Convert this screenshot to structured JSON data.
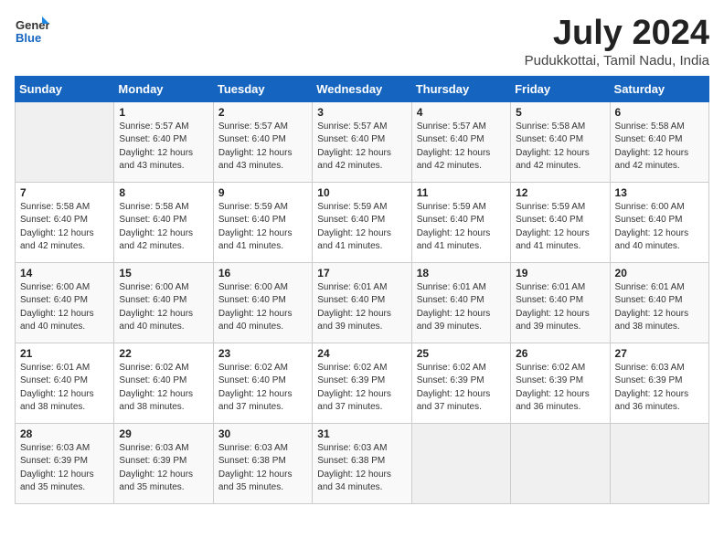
{
  "header": {
    "logo_general": "General",
    "logo_blue": "Blue",
    "month_year": "July 2024",
    "location": "Pudukkottai, Tamil Nadu, India"
  },
  "days_of_week": [
    "Sunday",
    "Monday",
    "Tuesday",
    "Wednesday",
    "Thursday",
    "Friday",
    "Saturday"
  ],
  "weeks": [
    [
      {
        "day": null,
        "sunrise": null,
        "sunset": null,
        "daylight": null
      },
      {
        "day": "1",
        "sunrise": "5:57 AM",
        "sunset": "6:40 PM",
        "daylight": "12 hours and 43 minutes."
      },
      {
        "day": "2",
        "sunrise": "5:57 AM",
        "sunset": "6:40 PM",
        "daylight": "12 hours and 43 minutes."
      },
      {
        "day": "3",
        "sunrise": "5:57 AM",
        "sunset": "6:40 PM",
        "daylight": "12 hours and 42 minutes."
      },
      {
        "day": "4",
        "sunrise": "5:57 AM",
        "sunset": "6:40 PM",
        "daylight": "12 hours and 42 minutes."
      },
      {
        "day": "5",
        "sunrise": "5:58 AM",
        "sunset": "6:40 PM",
        "daylight": "12 hours and 42 minutes."
      },
      {
        "day": "6",
        "sunrise": "5:58 AM",
        "sunset": "6:40 PM",
        "daylight": "12 hours and 42 minutes."
      }
    ],
    [
      {
        "day": "7",
        "sunrise": "5:58 AM",
        "sunset": "6:40 PM",
        "daylight": "12 hours and 42 minutes."
      },
      {
        "day": "8",
        "sunrise": "5:58 AM",
        "sunset": "6:40 PM",
        "daylight": "12 hours and 42 minutes."
      },
      {
        "day": "9",
        "sunrise": "5:59 AM",
        "sunset": "6:40 PM",
        "daylight": "12 hours and 41 minutes."
      },
      {
        "day": "10",
        "sunrise": "5:59 AM",
        "sunset": "6:40 PM",
        "daylight": "12 hours and 41 minutes."
      },
      {
        "day": "11",
        "sunrise": "5:59 AM",
        "sunset": "6:40 PM",
        "daylight": "12 hours and 41 minutes."
      },
      {
        "day": "12",
        "sunrise": "5:59 AM",
        "sunset": "6:40 PM",
        "daylight": "12 hours and 41 minutes."
      },
      {
        "day": "13",
        "sunrise": "6:00 AM",
        "sunset": "6:40 PM",
        "daylight": "12 hours and 40 minutes."
      }
    ],
    [
      {
        "day": "14",
        "sunrise": "6:00 AM",
        "sunset": "6:40 PM",
        "daylight": "12 hours and 40 minutes."
      },
      {
        "day": "15",
        "sunrise": "6:00 AM",
        "sunset": "6:40 PM",
        "daylight": "12 hours and 40 minutes."
      },
      {
        "day": "16",
        "sunrise": "6:00 AM",
        "sunset": "6:40 PM",
        "daylight": "12 hours and 40 minutes."
      },
      {
        "day": "17",
        "sunrise": "6:01 AM",
        "sunset": "6:40 PM",
        "daylight": "12 hours and 39 minutes."
      },
      {
        "day": "18",
        "sunrise": "6:01 AM",
        "sunset": "6:40 PM",
        "daylight": "12 hours and 39 minutes."
      },
      {
        "day": "19",
        "sunrise": "6:01 AM",
        "sunset": "6:40 PM",
        "daylight": "12 hours and 39 minutes."
      },
      {
        "day": "20",
        "sunrise": "6:01 AM",
        "sunset": "6:40 PM",
        "daylight": "12 hours and 38 minutes."
      }
    ],
    [
      {
        "day": "21",
        "sunrise": "6:01 AM",
        "sunset": "6:40 PM",
        "daylight": "12 hours and 38 minutes."
      },
      {
        "day": "22",
        "sunrise": "6:02 AM",
        "sunset": "6:40 PM",
        "daylight": "12 hours and 38 minutes."
      },
      {
        "day": "23",
        "sunrise": "6:02 AM",
        "sunset": "6:40 PM",
        "daylight": "12 hours and 37 minutes."
      },
      {
        "day": "24",
        "sunrise": "6:02 AM",
        "sunset": "6:39 PM",
        "daylight": "12 hours and 37 minutes."
      },
      {
        "day": "25",
        "sunrise": "6:02 AM",
        "sunset": "6:39 PM",
        "daylight": "12 hours and 37 minutes."
      },
      {
        "day": "26",
        "sunrise": "6:02 AM",
        "sunset": "6:39 PM",
        "daylight": "12 hours and 36 minutes."
      },
      {
        "day": "27",
        "sunrise": "6:03 AM",
        "sunset": "6:39 PM",
        "daylight": "12 hours and 36 minutes."
      }
    ],
    [
      {
        "day": "28",
        "sunrise": "6:03 AM",
        "sunset": "6:39 PM",
        "daylight": "12 hours and 35 minutes."
      },
      {
        "day": "29",
        "sunrise": "6:03 AM",
        "sunset": "6:39 PM",
        "daylight": "12 hours and 35 minutes."
      },
      {
        "day": "30",
        "sunrise": "6:03 AM",
        "sunset": "6:38 PM",
        "daylight": "12 hours and 35 minutes."
      },
      {
        "day": "31",
        "sunrise": "6:03 AM",
        "sunset": "6:38 PM",
        "daylight": "12 hours and 34 minutes."
      },
      {
        "day": null,
        "sunrise": null,
        "sunset": null,
        "daylight": null
      },
      {
        "day": null,
        "sunrise": null,
        "sunset": null,
        "daylight": null
      },
      {
        "day": null,
        "sunrise": null,
        "sunset": null,
        "daylight": null
      }
    ]
  ]
}
